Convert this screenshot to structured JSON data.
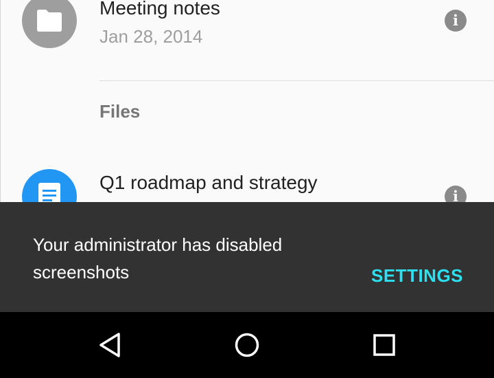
{
  "list": {
    "items": [
      {
        "title": "Meeting notes",
        "subtitle": "Jan 28, 2014",
        "icon": "folder-icon",
        "icon_color": "#9e9e9e"
      }
    ],
    "section_header": "Files",
    "files": [
      {
        "title": "Q1 roadmap and strategy",
        "icon": "document-icon",
        "icon_color": "#2196f3"
      }
    ]
  },
  "snackbar": {
    "message": "Your administrator has disabled screenshots",
    "action_label": "SETTINGS",
    "action_color": "#2de0f0"
  },
  "navbar": {
    "buttons": [
      "back-icon",
      "home-icon",
      "recents-icon"
    ]
  }
}
